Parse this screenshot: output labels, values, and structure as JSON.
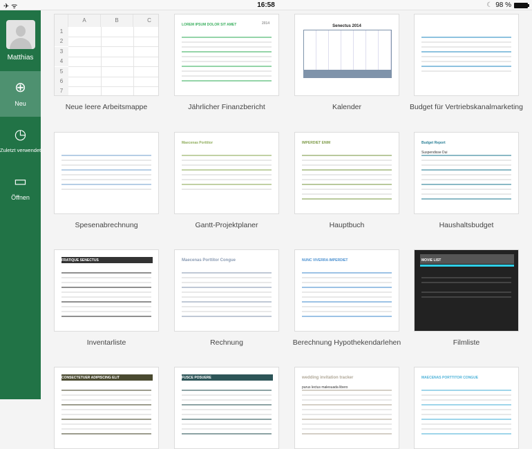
{
  "status_bar": {
    "left_icons": [
      "airplane-icon",
      "wifi-icon"
    ],
    "time": "16:58",
    "moon": "☾",
    "battery": "98 %"
  },
  "sidebar": {
    "user": "Matthias",
    "items": [
      {
        "label": "Neu",
        "icon": "new-document-icon",
        "selected": true
      },
      {
        "label": "Zuletzt verwendet",
        "icon": "clock-icon"
      },
      {
        "label": "Öffnen",
        "icon": "folder-icon"
      }
    ],
    "color": "#217346"
  },
  "blank_sheet": {
    "columns": [
      "A",
      "B",
      "C"
    ],
    "rows": [
      "1",
      "2",
      "3",
      "4",
      "5",
      "6",
      "7"
    ]
  },
  "templates": [
    {
      "label": "Neue leere Arbeitsmappe"
    },
    {
      "label": "Jährlicher Finanzbericht",
      "title": "LOREM IPSUM DOLOR SIT AMET",
      "year": "2014",
      "accent": "#3cb060"
    },
    {
      "label": "Kalender",
      "title": "Senectus 2014",
      "accent": "#7f93aa"
    },
    {
      "label": "Budget für Vertriebskanalmarketing",
      "accent": "#2f8fc5"
    },
    {
      "label": "Spesenabrechnung",
      "accent": "#7aa6cf"
    },
    {
      "label": "Gantt-Projektplaner",
      "title": "Maecenas Porttitor",
      "accent": "#8eac5a"
    },
    {
      "label": "Hauptbuch",
      "title": "IMPERDIET ENIM",
      "accent": "#7f9c4a"
    },
    {
      "label": "Haushaltsbudget",
      "title": "Budget Report",
      "subtitle": "Suspendisse Dui",
      "accent": "#2a7f96"
    },
    {
      "label": "Inventarliste",
      "title": "FRATIQUE SENECTUS",
      "accent": "#333333"
    },
    {
      "label": "Rechnung",
      "title": "Maecenas Porttitor Congue",
      "accent": "#8a9bb3"
    },
    {
      "label": "Berechnung Hypothekendarlehen",
      "title": "NUNC VIVERRA IMPERDIET",
      "accent": "#4a90d0"
    },
    {
      "label": "Filmliste",
      "title": "MOVIE LIST",
      "accent": "#222222"
    },
    {
      "label": "",
      "title": "CONSECTETUER ADIPISCING ELIT",
      "accent": "#4a4a30"
    },
    {
      "label": "",
      "title": "FUSCE POSUERE",
      "accent": "#2d5558"
    },
    {
      "label": "",
      "title": "wedding invitation tracker",
      "subtitle": "purus lectus malesuada libero",
      "accent": "#b0a898"
    },
    {
      "label": "",
      "title": "MAECENAS PORTTITOR CONGUE",
      "accent": "#4fb3d9"
    }
  ]
}
